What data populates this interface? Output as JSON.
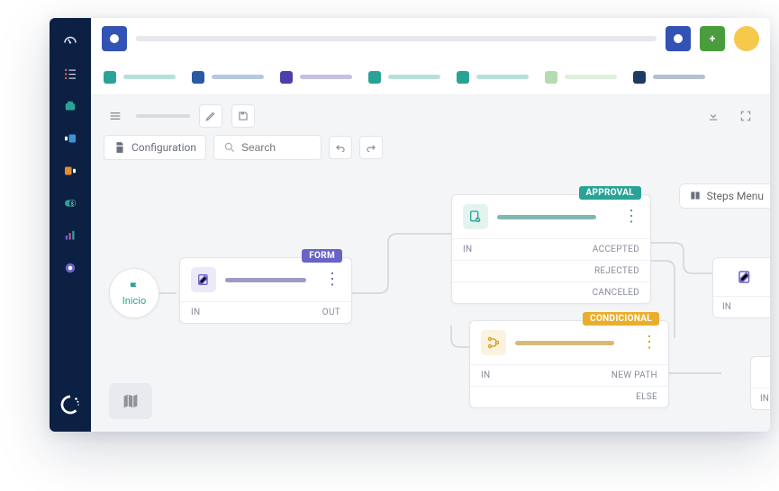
{
  "rail": {
    "items": [
      "dashboard",
      "tasks",
      "inbox",
      "pipeline-left",
      "pipeline-right",
      "finance",
      "analytics",
      "apps"
    ]
  },
  "topbar": {
    "add_label": "+",
    "search_placeholder": ""
  },
  "tabs": [
    {
      "c": "c-teal",
      "s": "s-teal"
    },
    {
      "c": "c-dblue",
      "s": "s-dblue"
    },
    {
      "c": "c-purple",
      "s": "s-purple"
    },
    {
      "c": "c-teal",
      "s": "s-teal"
    },
    {
      "c": "c-teal",
      "s": "s-teal"
    },
    {
      "c": "c-ltgreen",
      "s": "s-ltgreen"
    },
    {
      "c": "c-navy",
      "s": "s-navy"
    }
  ],
  "toolbar": {
    "config_label": "Configuration",
    "search_placeholder": "Search",
    "steps_menu_label": "Steps Menu"
  },
  "start": {
    "label": "Inicio"
  },
  "form_node": {
    "tag": "FORM",
    "in": "IN",
    "out": "OUT"
  },
  "approval_node": {
    "tag": "APPROVAL",
    "in": "IN",
    "outs": [
      "ACCEPTED",
      "REJECTED",
      "CANCELED"
    ]
  },
  "conditional_node": {
    "tag": "CONDICIONAL",
    "in": "IN",
    "outs": [
      "NEW PATH",
      "ELSE"
    ]
  },
  "stub_in": "IN"
}
